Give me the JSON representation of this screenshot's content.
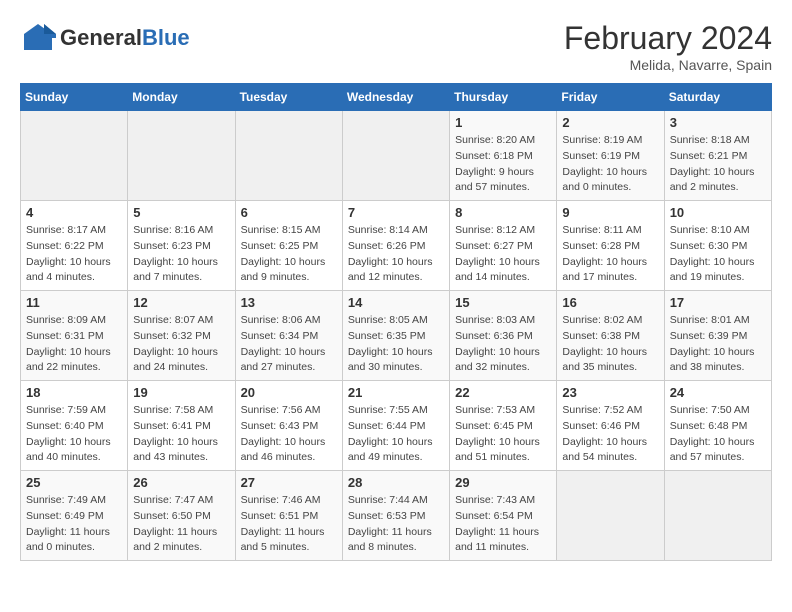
{
  "header": {
    "logo_general": "General",
    "logo_blue": "Blue",
    "month_title": "February 2024",
    "location": "Melida, Navarre, Spain"
  },
  "weekdays": [
    "Sunday",
    "Monday",
    "Tuesday",
    "Wednesday",
    "Thursday",
    "Friday",
    "Saturday"
  ],
  "weeks": [
    [
      {
        "day": "",
        "info": ""
      },
      {
        "day": "",
        "info": ""
      },
      {
        "day": "",
        "info": ""
      },
      {
        "day": "",
        "info": ""
      },
      {
        "day": "1",
        "info": "Sunrise: 8:20 AM\nSunset: 6:18 PM\nDaylight: 9 hours\nand 57 minutes."
      },
      {
        "day": "2",
        "info": "Sunrise: 8:19 AM\nSunset: 6:19 PM\nDaylight: 10 hours\nand 0 minutes."
      },
      {
        "day": "3",
        "info": "Sunrise: 8:18 AM\nSunset: 6:21 PM\nDaylight: 10 hours\nand 2 minutes."
      }
    ],
    [
      {
        "day": "4",
        "info": "Sunrise: 8:17 AM\nSunset: 6:22 PM\nDaylight: 10 hours\nand 4 minutes."
      },
      {
        "day": "5",
        "info": "Sunrise: 8:16 AM\nSunset: 6:23 PM\nDaylight: 10 hours\nand 7 minutes."
      },
      {
        "day": "6",
        "info": "Sunrise: 8:15 AM\nSunset: 6:25 PM\nDaylight: 10 hours\nand 9 minutes."
      },
      {
        "day": "7",
        "info": "Sunrise: 8:14 AM\nSunset: 6:26 PM\nDaylight: 10 hours\nand 12 minutes."
      },
      {
        "day": "8",
        "info": "Sunrise: 8:12 AM\nSunset: 6:27 PM\nDaylight: 10 hours\nand 14 minutes."
      },
      {
        "day": "9",
        "info": "Sunrise: 8:11 AM\nSunset: 6:28 PM\nDaylight: 10 hours\nand 17 minutes."
      },
      {
        "day": "10",
        "info": "Sunrise: 8:10 AM\nSunset: 6:30 PM\nDaylight: 10 hours\nand 19 minutes."
      }
    ],
    [
      {
        "day": "11",
        "info": "Sunrise: 8:09 AM\nSunset: 6:31 PM\nDaylight: 10 hours\nand 22 minutes."
      },
      {
        "day": "12",
        "info": "Sunrise: 8:07 AM\nSunset: 6:32 PM\nDaylight: 10 hours\nand 24 minutes."
      },
      {
        "day": "13",
        "info": "Sunrise: 8:06 AM\nSunset: 6:34 PM\nDaylight: 10 hours\nand 27 minutes."
      },
      {
        "day": "14",
        "info": "Sunrise: 8:05 AM\nSunset: 6:35 PM\nDaylight: 10 hours\nand 30 minutes."
      },
      {
        "day": "15",
        "info": "Sunrise: 8:03 AM\nSunset: 6:36 PM\nDaylight: 10 hours\nand 32 minutes."
      },
      {
        "day": "16",
        "info": "Sunrise: 8:02 AM\nSunset: 6:38 PM\nDaylight: 10 hours\nand 35 minutes."
      },
      {
        "day": "17",
        "info": "Sunrise: 8:01 AM\nSunset: 6:39 PM\nDaylight: 10 hours\nand 38 minutes."
      }
    ],
    [
      {
        "day": "18",
        "info": "Sunrise: 7:59 AM\nSunset: 6:40 PM\nDaylight: 10 hours\nand 40 minutes."
      },
      {
        "day": "19",
        "info": "Sunrise: 7:58 AM\nSunset: 6:41 PM\nDaylight: 10 hours\nand 43 minutes."
      },
      {
        "day": "20",
        "info": "Sunrise: 7:56 AM\nSunset: 6:43 PM\nDaylight: 10 hours\nand 46 minutes."
      },
      {
        "day": "21",
        "info": "Sunrise: 7:55 AM\nSunset: 6:44 PM\nDaylight: 10 hours\nand 49 minutes."
      },
      {
        "day": "22",
        "info": "Sunrise: 7:53 AM\nSunset: 6:45 PM\nDaylight: 10 hours\nand 51 minutes."
      },
      {
        "day": "23",
        "info": "Sunrise: 7:52 AM\nSunset: 6:46 PM\nDaylight: 10 hours\nand 54 minutes."
      },
      {
        "day": "24",
        "info": "Sunrise: 7:50 AM\nSunset: 6:48 PM\nDaylight: 10 hours\nand 57 minutes."
      }
    ],
    [
      {
        "day": "25",
        "info": "Sunrise: 7:49 AM\nSunset: 6:49 PM\nDaylight: 11 hours\nand 0 minutes."
      },
      {
        "day": "26",
        "info": "Sunrise: 7:47 AM\nSunset: 6:50 PM\nDaylight: 11 hours\nand 2 minutes."
      },
      {
        "day": "27",
        "info": "Sunrise: 7:46 AM\nSunset: 6:51 PM\nDaylight: 11 hours\nand 5 minutes."
      },
      {
        "day": "28",
        "info": "Sunrise: 7:44 AM\nSunset: 6:53 PM\nDaylight: 11 hours\nand 8 minutes."
      },
      {
        "day": "29",
        "info": "Sunrise: 7:43 AM\nSunset: 6:54 PM\nDaylight: 11 hours\nand 11 minutes."
      },
      {
        "day": "",
        "info": ""
      },
      {
        "day": "",
        "info": ""
      }
    ]
  ]
}
